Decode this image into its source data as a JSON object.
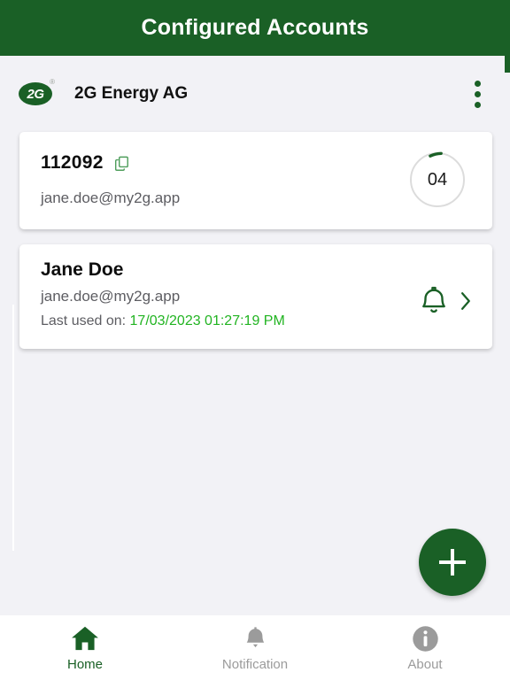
{
  "theme": {
    "header_green": "#1a6026",
    "accent_green": "#1a6026",
    "timestamp_green": "#22b422",
    "page_background": "#f2f2f6",
    "card_background": "#ffffff",
    "muted_text": "#5d5d62",
    "inactive_nav": "#9b9b9b"
  },
  "appbar": {
    "title": "Configured Accounts",
    "menu_icon": "more-vertical-icon"
  },
  "organisation": {
    "logo_text": "2G",
    "logo_trademark": "®",
    "name": "2G Energy AG",
    "overflow_menu": "more-vertical-icon"
  },
  "code_card": {
    "code": "112092",
    "copy_icon": "copy-icon",
    "email": "jane.doe@my2g.app",
    "countdown": {
      "value": "04",
      "progress_percent": 12,
      "track_color": "#dcdcdc",
      "arc_color": "#1a6026"
    }
  },
  "account_card": {
    "name": "Jane Doe",
    "email": "jane.doe@my2g.app",
    "last_used_label": "Last used on:",
    "last_used_value": "17/03/2023 01:27:19 PM",
    "bell_icon": "bell-icon",
    "chevron_icon": "chevron-right-icon"
  },
  "fab": {
    "icon": "plus-icon",
    "label": "Add account"
  },
  "bottom_nav": {
    "items": [
      {
        "label": "Home",
        "icon": "home-icon",
        "active": true
      },
      {
        "label": "Notification",
        "icon": "bell-icon",
        "active": false
      },
      {
        "label": "About",
        "icon": "info-circle-icon",
        "active": false
      }
    ]
  }
}
